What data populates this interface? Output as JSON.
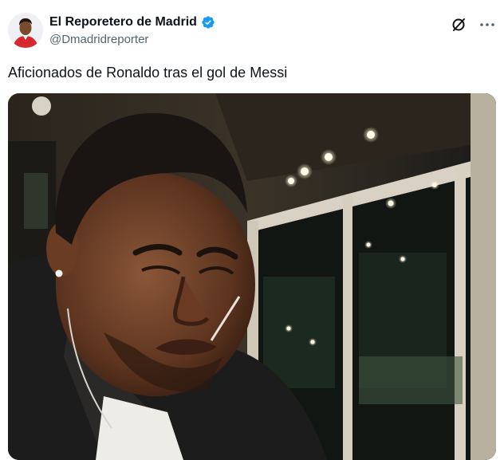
{
  "tweet": {
    "author": {
      "display_name": "El Reporetero de Madrid",
      "handle": "@Dmadridreporter",
      "verified": true,
      "avatar_icon": "avatar-icon"
    },
    "text": "Aficionados de Ronaldo tras el gol de Messi",
    "actions": {
      "grok_icon": "slash-circle-icon",
      "more_icon": "more-options-icon"
    },
    "media": {
      "kind": "photo"
    }
  },
  "colors": {
    "verified_badge": "#1d9bf0",
    "handle": "#536471",
    "text": "#0f1419"
  }
}
